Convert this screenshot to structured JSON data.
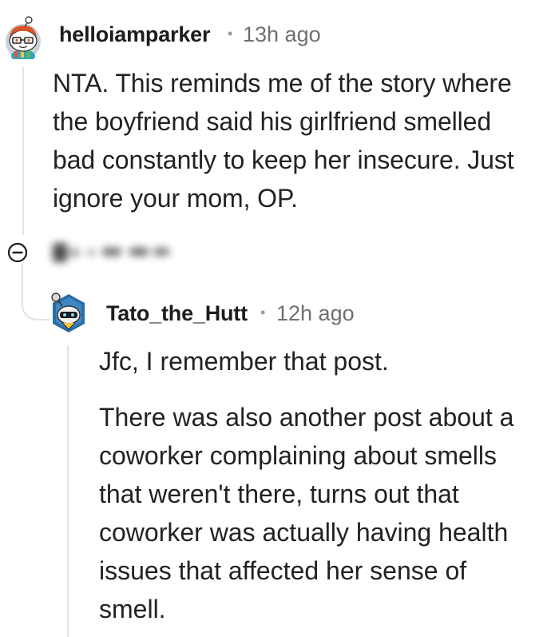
{
  "comment1": {
    "username": "helloiamparker",
    "separator": "•",
    "timestamp": "13h ago",
    "body": "NTA. This reminds me of the story where\nthe boyfriend said his girlfriend smelled\nbad constantly to keep her insecure. Just\nignore your mom, OP.",
    "avatar_icon": "snoo-avatar-icon"
  },
  "collapse": {
    "icon": "collapse-minus-icon"
  },
  "comment2": {
    "username": "Tato_the_Hutt",
    "separator": "•",
    "timestamp": "12h ago",
    "paragraphs": [
      "Jfc, I remember that post.",
      "There was also another post about a\ncoworker complaining about smells\nthat weren't there, turns out that\ncoworker was actually having health\nissues that affected her sense of\nsmell."
    ],
    "avatar_icon": "snoo-avatar-icon"
  },
  "colors": {
    "text": "#1c1c1c",
    "meta": "#6f6f6f",
    "thread_line": "#e4e4e4",
    "background": "#ffffff"
  }
}
